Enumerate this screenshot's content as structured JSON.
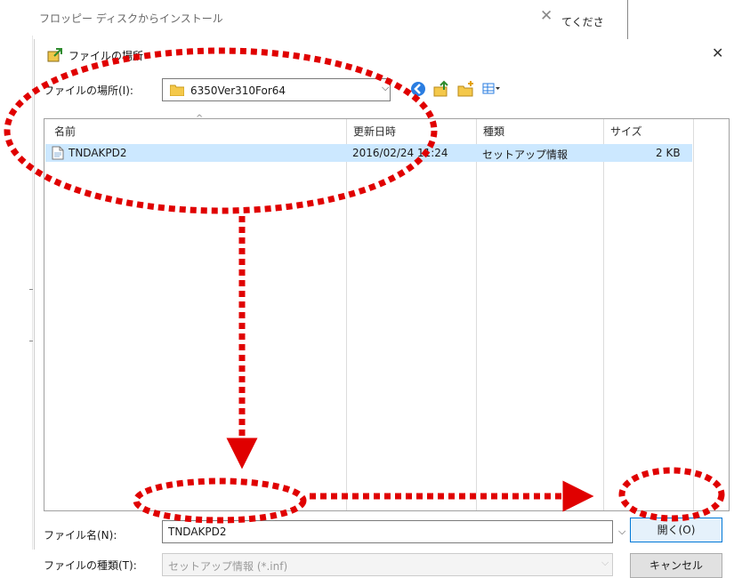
{
  "background": {
    "title": "フロッピー ディスクからインストール",
    "partial_text": "てくださ"
  },
  "dialog": {
    "title": "ファイルの場所",
    "look_in_label": "ファイルの場所(I):",
    "look_in_value": "6350Ver310For64",
    "toolbar": [
      "back-icon",
      "up-folder-icon",
      "new-folder-icon",
      "view-menu-icon"
    ],
    "columns": [
      "名前",
      "更新日時",
      "種類",
      "サイズ"
    ],
    "files": [
      {
        "name": "TNDAKPD2",
        "modified": "2016/02/24 11:24",
        "type": "セットアップ情報",
        "size": "2 KB"
      }
    ],
    "filename_label": "ファイル名(N):",
    "filename_value": "TNDAKPD2",
    "filetype_label": "ファイルの種類(T):",
    "filetype_value": "セットアップ情報 (*.inf)",
    "open_label": "開く(O)",
    "cancel_label": "キャンセル"
  },
  "colors": {
    "annotation": "#e00000",
    "selection": "#cce8ff",
    "accent": "#0078d7"
  }
}
